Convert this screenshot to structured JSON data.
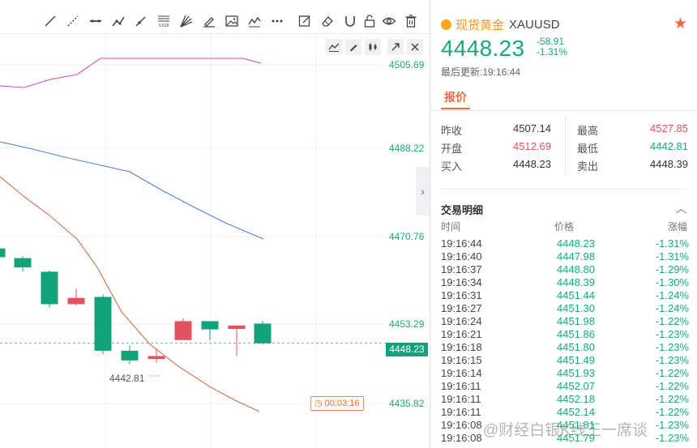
{
  "chart": {
    "price_axis": [
      "4505.69",
      "4488.22",
      "4470.76",
      "4453.29",
      "4448.23",
      "4435.82"
    ],
    "current_price_tag": "4448.23",
    "low_marker": "4442.81",
    "countdown": "00:03:16",
    "colors": {
      "up": "#e0535f",
      "down": "#12a37a",
      "ma_purple": "#d94fb1",
      "ma_blue": "#5b7fd6",
      "ma_brown": "#c8734a"
    },
    "candles": [
      {
        "o": 4467.8,
        "c": 4466.0,
        "h": 4468.0,
        "l": 4465.8
      },
      {
        "o": 4465.8,
        "c": 4463.9,
        "h": 4466.2,
        "l": 4463.0
      },
      {
        "o": 4463.0,
        "c": 4456.3,
        "h": 4463.3,
        "l": 4455.6
      },
      {
        "o": 4456.3,
        "c": 4457.6,
        "h": 4459.5,
        "l": 4456.0
      },
      {
        "o": 4457.8,
        "c": 4446.7,
        "h": 4458.3,
        "l": 4446.0
      },
      {
        "o": 4446.7,
        "c": 4444.7,
        "h": 4447.8,
        "l": 4443.9
      },
      {
        "o": 4445.0,
        "c": 4445.6,
        "h": 4447.2,
        "l": 4444.2
      },
      {
        "o": 4448.9,
        "c": 4452.8,
        "h": 4453.4,
        "l": 4448.9
      },
      {
        "o": 4452.8,
        "c": 4451.1,
        "h": 4452.8,
        "l": 4448.9
      },
      {
        "o": 4451.2,
        "c": 4451.9,
        "h": 4451.9,
        "l": 4445.6
      },
      {
        "o": 4452.3,
        "c": 4448.23,
        "h": 4452.9,
        "l": 4448.0
      }
    ]
  },
  "toolbar": {
    "icons": [
      "trend-line-icon",
      "ray-icon",
      "horizontal-line-icon",
      "polyline-icon",
      "arrow-icon",
      "fibonacci-icon",
      "fan-icon",
      "brush-icon",
      "image-icon",
      "pattern-icon",
      "more-icon",
      "note-icon",
      "eraser-icon",
      "magnet-icon",
      "lock-icon",
      "eye-icon",
      "trash-icon"
    ],
    "fib_label": "0.618"
  },
  "symbol": {
    "name": "现货黄金",
    "code": "XAUUSD",
    "price": "4448.23",
    "change": "-58.91",
    "change_pct": "-1.31%",
    "updated": "最后更新:19:16:44"
  },
  "tab": {
    "label": "报价"
  },
  "quote": {
    "prev_close_label": "昨收",
    "prev_close": "4507.14",
    "open_label": "开盘",
    "open": "4512.69",
    "bid_label": "买入",
    "bid": "4448.23",
    "high_label": "最高",
    "high": "4527.85",
    "low_label": "最低",
    "low": "4442.81",
    "ask_label": "卖出",
    "ask": "4448.39"
  },
  "trades": {
    "title": "交易明细",
    "col_time": "时间",
    "col_price": "价格",
    "col_change": "涨幅",
    "rows": [
      {
        "time": "19:16:44",
        "price": "4448.23",
        "change": "-1.31%"
      },
      {
        "time": "19:16:40",
        "price": "4447.98",
        "change": "-1.31%"
      },
      {
        "time": "19:16:37",
        "price": "4448.80",
        "change": "-1.29%"
      },
      {
        "time": "19:16:34",
        "price": "4448.39",
        "change": "-1.30%"
      },
      {
        "time": "19:16:31",
        "price": "4451.44",
        "change": "-1.24%"
      },
      {
        "time": "19:16:27",
        "price": "4451.30",
        "change": "-1.24%"
      },
      {
        "time": "19:16:24",
        "price": "4451.98",
        "change": "-1.22%"
      },
      {
        "time": "19:16:21",
        "price": "4451.86",
        "change": "-1.23%"
      },
      {
        "time": "19:16:18",
        "price": "4451.80",
        "change": "-1.23%"
      },
      {
        "time": "19:16:15",
        "price": "4451.49",
        "change": "-1.23%"
      },
      {
        "time": "19:16:14",
        "price": "4451.93",
        "change": "-1.22%"
      },
      {
        "time": "19:16:11",
        "price": "4452.07",
        "change": "-1.22%"
      },
      {
        "time": "19:16:11",
        "price": "4452.18",
        "change": "-1.22%"
      },
      {
        "time": "19:16:11",
        "price": "4452.14",
        "change": "-1.22%"
      },
      {
        "time": "19:16:08",
        "price": "4451.81",
        "change": "-1.23%"
      },
      {
        "time": "19:16:08",
        "price": "4451.79",
        "change": "-1.23%"
      }
    ]
  },
  "watermark": "@财经白银K线王一席谈"
}
